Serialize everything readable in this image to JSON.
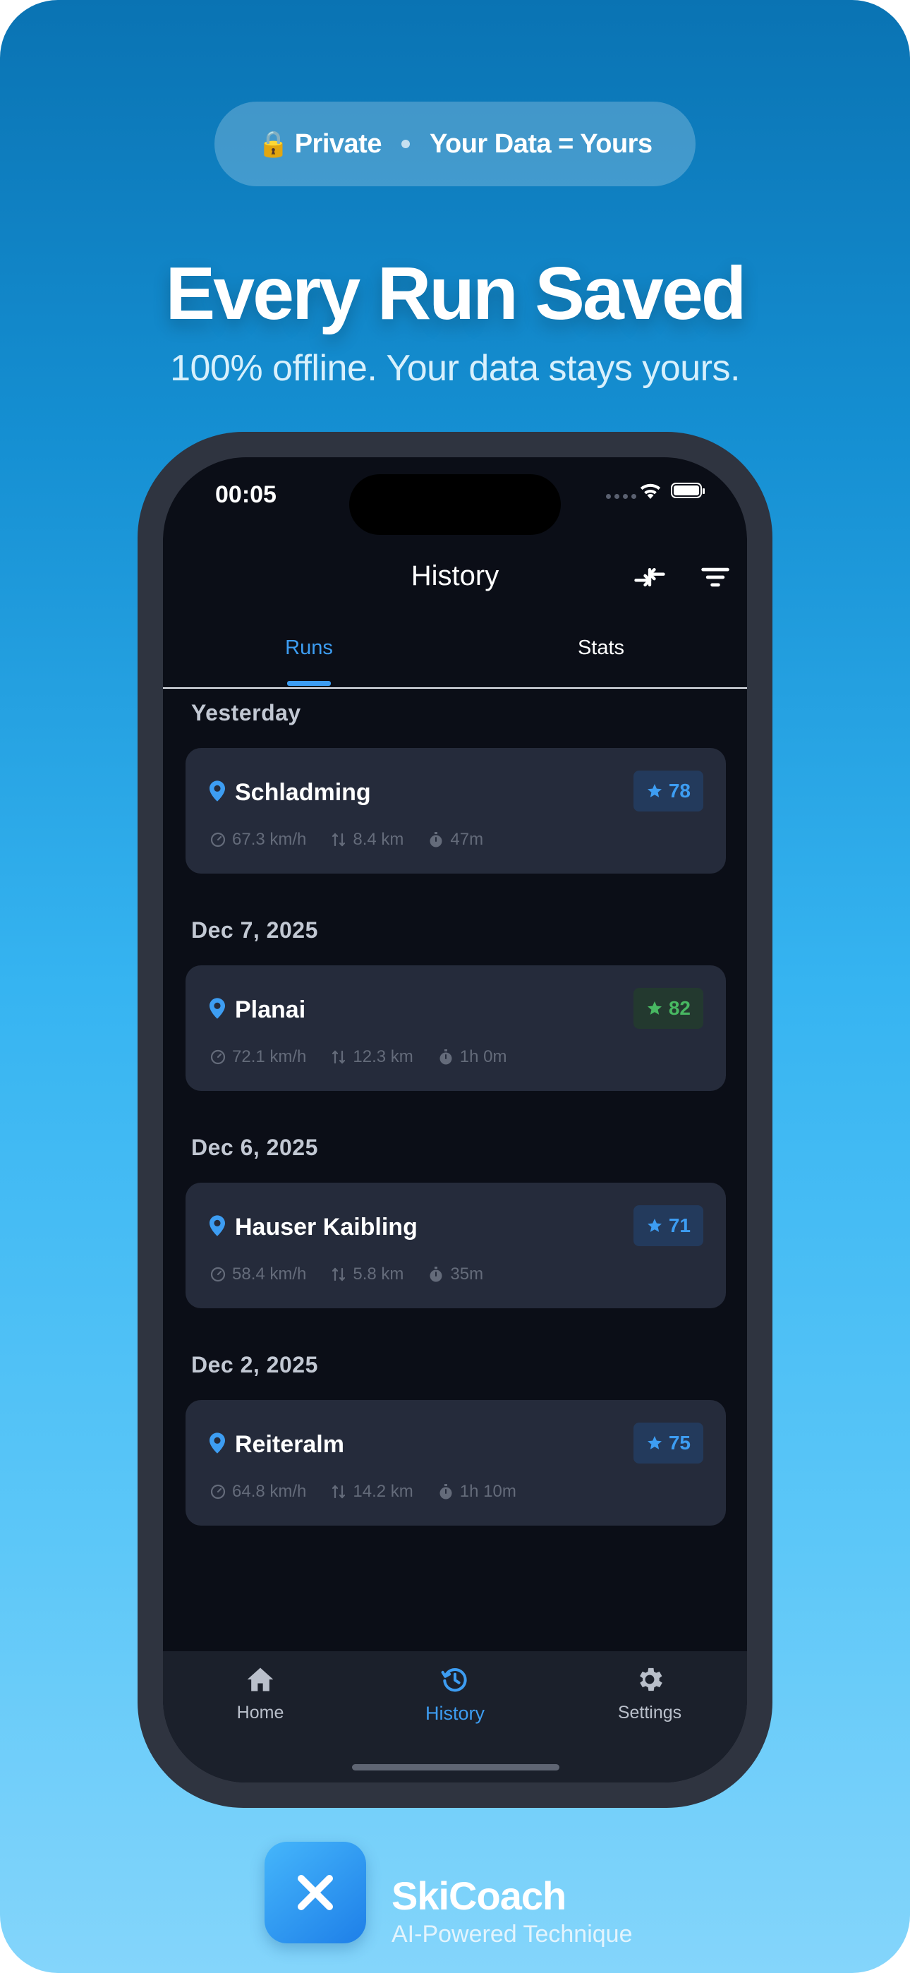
{
  "promo": {
    "privacy": {
      "lock_glyph": "🔒",
      "label_left": "Private",
      "label_right": "Your Data = Yours"
    },
    "title": "Every Run Saved",
    "subtitle": "100% offline. Your data stays yours."
  },
  "status_bar": {
    "time": "00:05"
  },
  "header": {
    "title": "History",
    "actions": [
      "compare-arrows-icon",
      "filter-icon"
    ]
  },
  "tabs": [
    {
      "label": "Runs",
      "active": true
    },
    {
      "label": "Stats",
      "active": false
    }
  ],
  "sections": [
    {
      "title": "Yesterday",
      "runs": [
        {
          "resort": "Schladming",
          "score": "78",
          "score_color": "blue",
          "speed": "67.3 km/h",
          "distance": "8.4 km",
          "duration": "47m"
        }
      ]
    },
    {
      "title": "Dec 7, 2025",
      "runs": [
        {
          "resort": "Planai",
          "score": "82",
          "score_color": "green",
          "speed": "72.1 km/h",
          "distance": "12.3 km",
          "duration": "1h 0m"
        }
      ]
    },
    {
      "title": "Dec 6, 2025",
      "runs": [
        {
          "resort": "Hauser Kaibling",
          "score": "71",
          "score_color": "blue",
          "speed": "58.4 km/h",
          "distance": "5.8 km",
          "duration": "35m"
        }
      ]
    },
    {
      "title": "Dec 2, 2025",
      "runs": [
        {
          "resort": "Reiteralm",
          "score": "75",
          "score_color": "blue",
          "speed": "64.8 km/h",
          "distance": "14.2 km",
          "duration": "1h 10m"
        }
      ]
    }
  ],
  "bottom_nav": [
    {
      "label": "Home",
      "icon": "home-icon",
      "active": false
    },
    {
      "label": "History",
      "icon": "history-icon",
      "active": true
    },
    {
      "label": "Settings",
      "icon": "gear-icon",
      "active": false
    }
  ],
  "brand": {
    "name": "SkiCoach",
    "tagline": "AI-Powered Technique"
  },
  "colors": {
    "accent_blue": "#3d9df2",
    "score_green": "#48b862",
    "card_bg": "#252b3b",
    "screen_bg": "#0b0e17"
  }
}
